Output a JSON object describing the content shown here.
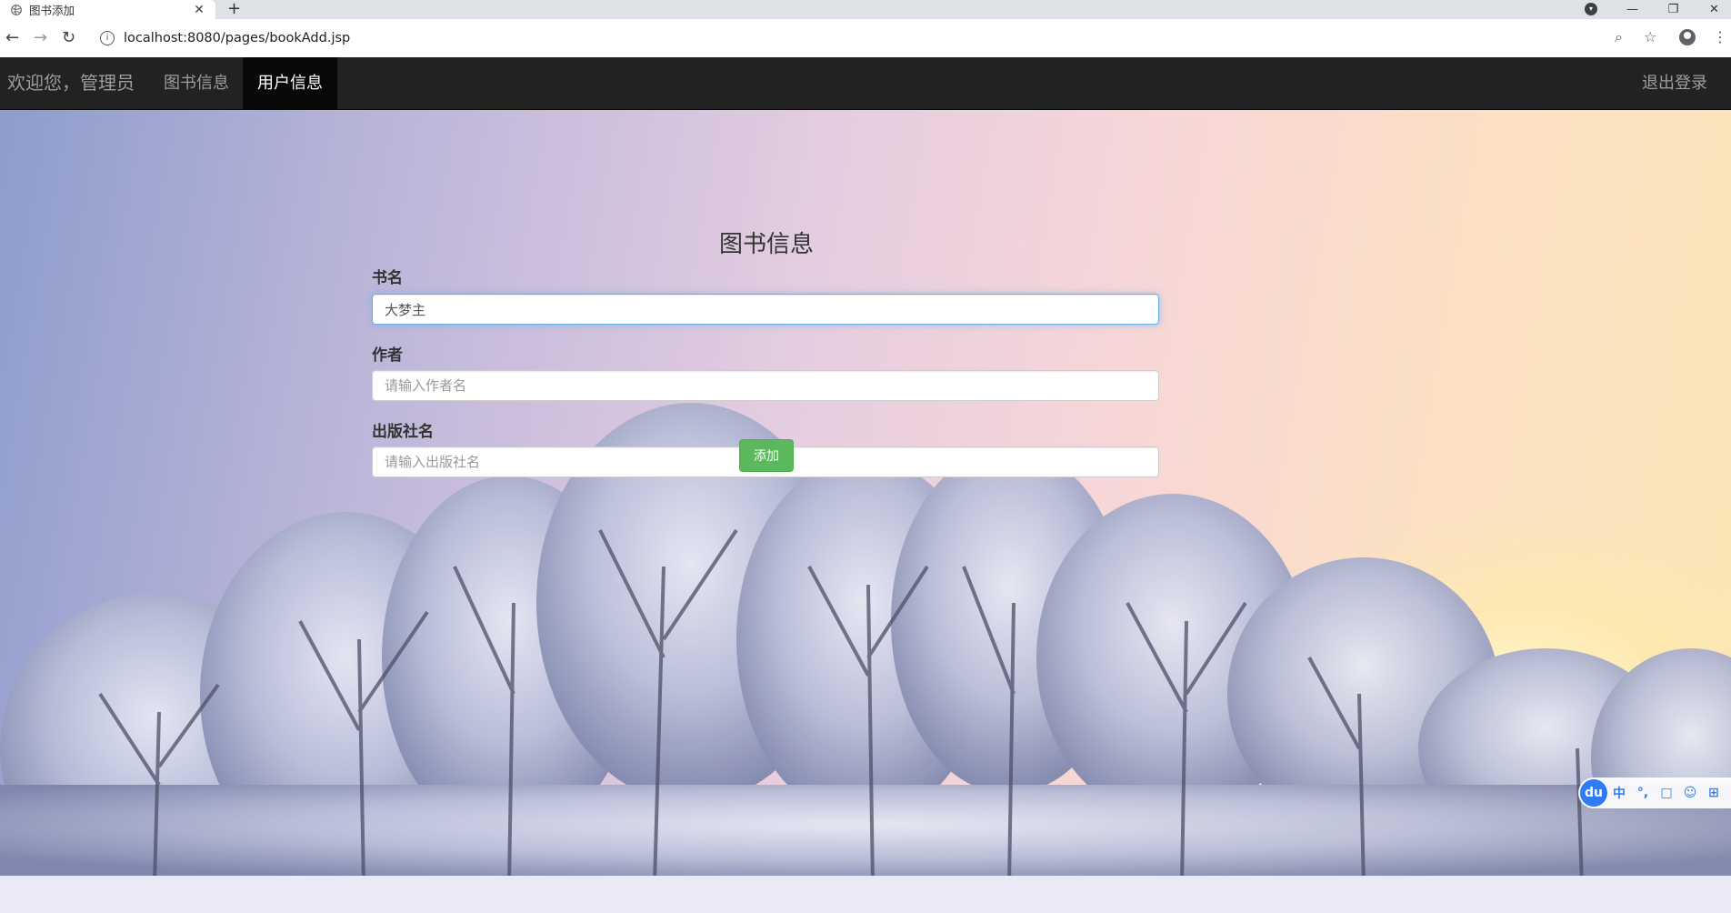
{
  "browser": {
    "tab_title": "图书添加",
    "new_tab": "+",
    "url": "localhost:8080/pages/bookAdd.jsp",
    "icons": [
      "globe-icon",
      "close-icon",
      "plus-icon",
      "back-icon",
      "forward-icon",
      "reload-icon",
      "info-icon",
      "zoom-icon",
      "star-icon",
      "profile-icon",
      "menu-icon",
      "minimize-icon",
      "restore-icon"
    ]
  },
  "navbar": {
    "brand": "欢迎您，管理员",
    "items": [
      {
        "label": "图书信息",
        "active": false
      },
      {
        "label": "用户信息",
        "active": true
      }
    ],
    "logout": "退出登录"
  },
  "form": {
    "title": "图书信息",
    "book_name": {
      "label": "书名",
      "value": "大梦主",
      "placeholder": ""
    },
    "author": {
      "label": "作者",
      "value": "",
      "placeholder": "请输入作者名"
    },
    "publisher": {
      "label": "出版社名",
      "value": "",
      "placeholder": "请输入出版社名"
    },
    "submit_label": "添加"
  },
  "ime": {
    "logo": "du",
    "items": [
      "中",
      "°,",
      "□",
      "☺",
      "⊞"
    ]
  },
  "colors": {
    "navbar_bg": "#222222",
    "nav_active_bg": "#080808",
    "button_success": "#5cb85c",
    "focus_border": "#66afe9"
  }
}
